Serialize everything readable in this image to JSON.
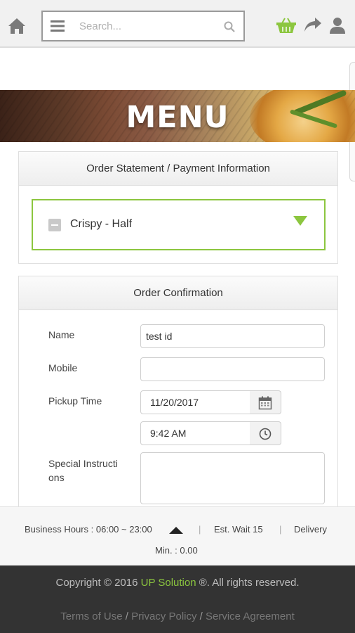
{
  "header": {
    "search_placeholder": "Search..."
  },
  "banner": {
    "title": "MENU"
  },
  "order_statement": {
    "title": "Order Statement / Payment Information",
    "items": [
      {
        "label": "Crispy - Half"
      }
    ]
  },
  "order_confirmation": {
    "title": "Order Confirmation",
    "name_label": "Name",
    "name_value": "test id",
    "mobile_label": "Mobile",
    "mobile_value": "",
    "pickup_label": "Pickup Time",
    "pickup_date": "11/20/2017",
    "pickup_time": "9:42 AM",
    "instructions_label_line1": "Special Instructi",
    "instructions_label_line2": "ons",
    "instructions_value": ""
  },
  "info": {
    "hours": "Business Hours : 06:00 ~ 23:00",
    "sep1": "|",
    "wait_label": "Est. Wait",
    "wait_value": "15",
    "sep2": "|",
    "delivery": "Delivery",
    "min": "Min. : 0.00"
  },
  "footer": {
    "copyright_prefix": "Copyright © 2016 ",
    "brand": "UP Solution",
    "copyright_suffix": " ®. All rights reserved.",
    "links": [
      "Terms of Use",
      "Privacy Policy",
      "Service Agreement"
    ],
    "separator": "/"
  },
  "colors": {
    "accent": "#8cc63f",
    "footer_bg": "#333333",
    "topbar_bg": "#f1f1f1"
  }
}
